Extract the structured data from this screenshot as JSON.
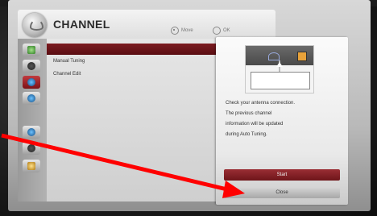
{
  "header": {
    "title": "CHANNEL",
    "hint_move": "Move",
    "hint_ok": "OK"
  },
  "sidebar": {
    "icons": [
      "green-grid-icon",
      "dish-icon",
      "clock-icon",
      "globe-icon",
      "gear-icon",
      "support-icon"
    ]
  },
  "menu": {
    "items": [
      {
        "label": "",
        "selected": true
      },
      {
        "label": "Manual Tuning",
        "selected": false
      },
      {
        "label": "Channel Edit",
        "selected": false
      }
    ]
  },
  "dialog": {
    "message_line1": "Check your antenna connection.",
    "message_line2": "The previous channel",
    "message_line3": "information will be updated",
    "message_line4": "during Auto Tuning.",
    "start_label": "Start",
    "close_label": "Close"
  },
  "colors": {
    "selected_row": "#7b1b20",
    "start_button": "#9a2e34",
    "arrow": "#ff0000"
  }
}
